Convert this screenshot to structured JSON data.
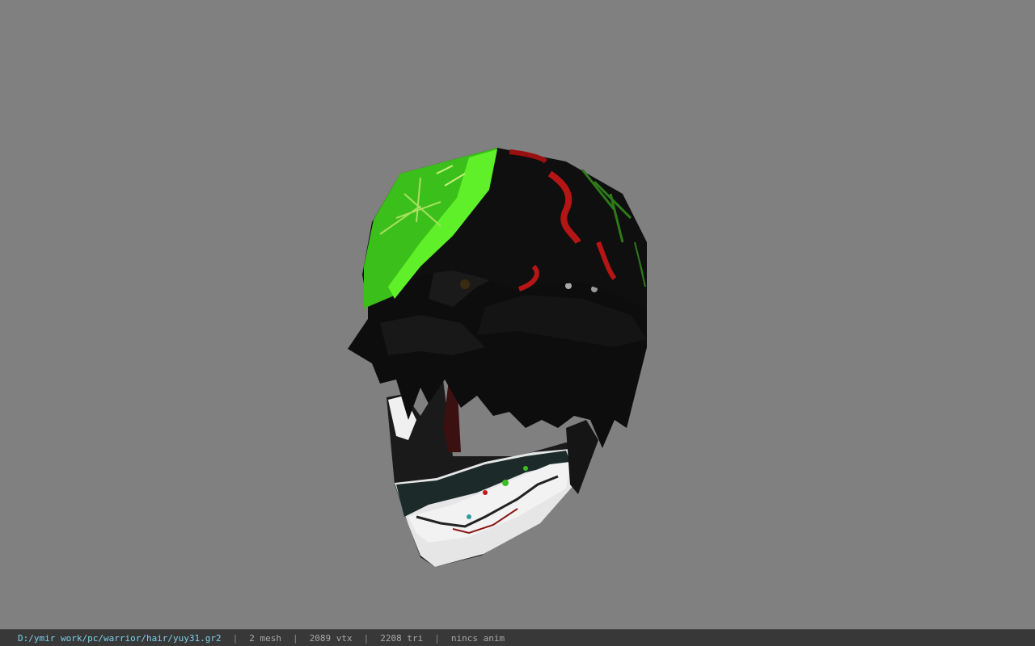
{
  "window": {
    "background": "#808080"
  },
  "viewport": {
    "model": "hair-with-bandana-and-mask",
    "colors": {
      "bandana_green": "#3fbf1f",
      "bandana_dark": "#101010",
      "accent_red": "#b01818",
      "hair_black": "#0c0c0c",
      "mask_white": "#e8e8e8"
    }
  },
  "status_bar": {
    "file_path": "D:/ymir work/pc/warrior/hair/yuy31.gr2",
    "separator": "|",
    "mesh": "2 mesh",
    "vertices": "2089 vtx",
    "triangles": "2208 tri",
    "anim": "nincs anim"
  }
}
